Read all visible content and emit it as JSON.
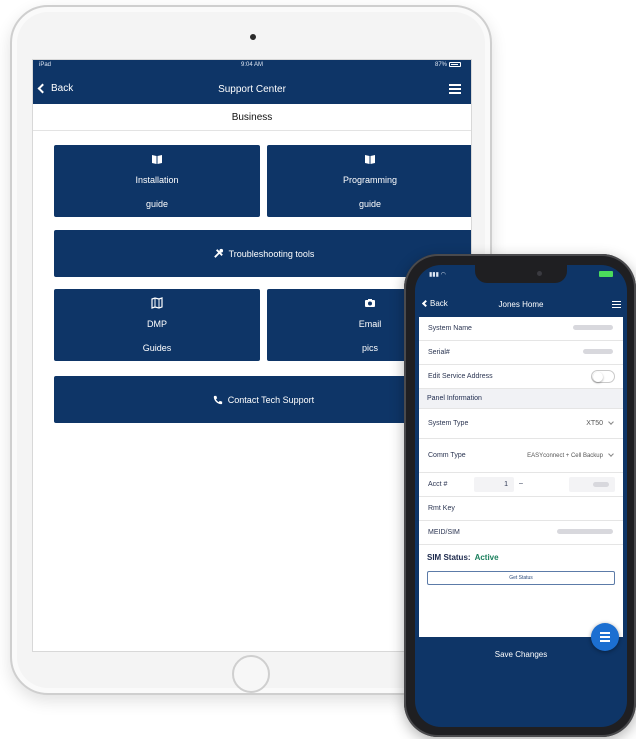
{
  "ipad": {
    "status": {
      "carrier": "iPad",
      "time": "9:04 AM",
      "battery": "87%"
    },
    "nav": {
      "back_label": "Back",
      "title": "Support Center"
    },
    "section_title": "Business",
    "tiles": {
      "installation": {
        "line1": "Installation",
        "line2": "guide",
        "icon": "book-icon"
      },
      "programming": {
        "line1": "Programming",
        "line2": "guide",
        "icon": "book-icon"
      },
      "troubleshooting": {
        "label": "Troubleshooting tools",
        "icon": "tools-icon"
      },
      "dmp_guides": {
        "line1": "DMP",
        "line2": "Guides",
        "icon": "map-icon"
      },
      "email_pics": {
        "line1": "Email",
        "line2": "pics",
        "icon": "camera-icon"
      },
      "contact": {
        "label": "Contact Tech Support",
        "icon": "phone-icon"
      }
    }
  },
  "iphone": {
    "nav": {
      "back_label": "Back",
      "title": "Jones Home"
    },
    "rows": {
      "system_name": "System Name",
      "serial": "Serial#",
      "edit_service_address": "Edit Service Address",
      "panel_information": "Panel Information",
      "system_type": {
        "label": "System Type",
        "value": "XT50"
      },
      "comm_type": {
        "label": "Comm Type",
        "value": "EASYconnect + Cell Backup"
      },
      "acct": {
        "label": "Acct #",
        "value": "1",
        "dash": "–"
      },
      "rmt_key": "Rmt Key",
      "meid_sim": "MEID/SIM"
    },
    "sim_status": {
      "label": "SIM Status:",
      "value": "Active"
    },
    "get_status_label": "Get Status",
    "footer_label": "Save Changes"
  },
  "colors": {
    "brand_navy": "#0e3567",
    "fab_blue": "#1c6fd1",
    "active_green": "#1a7f5c"
  }
}
